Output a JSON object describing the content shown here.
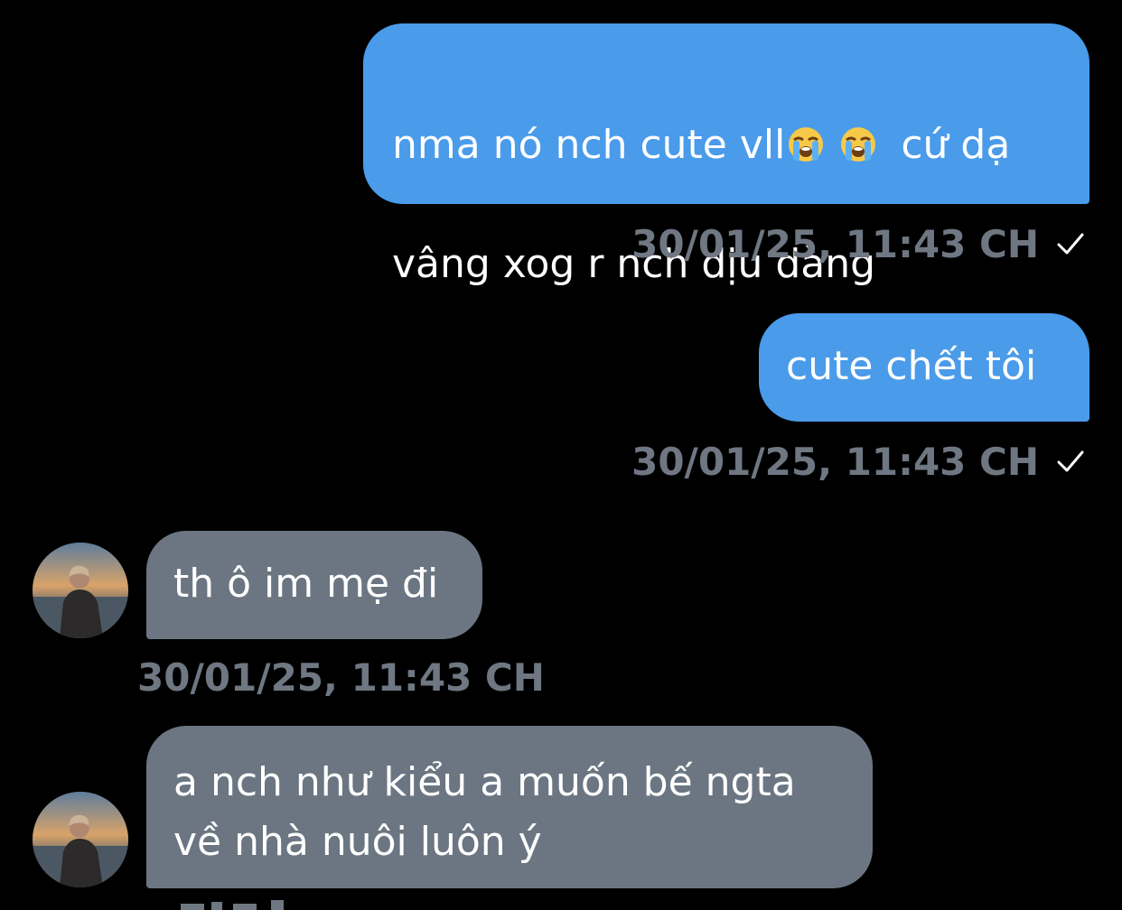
{
  "messages": [
    {
      "direction": "sent",
      "line1_text": "nma nó nch cute vll",
      "line1_emoji": "loudly-crying-face",
      "line1_tail": "cứ dạ",
      "line2": "vâng xog r nch dịu dàng",
      "timestamp": "30/01/25, 11:43 CH",
      "status": "check-icon"
    },
    {
      "direction": "sent",
      "text": "cute chết tôi",
      "timestamp": "30/01/25, 11:43 CH",
      "status": "check-icon"
    },
    {
      "direction": "received",
      "text": "th ô im mẹ đi",
      "timestamp": "30/01/25, 11:43 CH"
    },
    {
      "direction": "received",
      "text": "a nch như kiểu a muốn bế ngta\nvề nhà nuôi luôn ý"
    }
  ],
  "colors": {
    "background": "#000000",
    "sent_bubble": "#4a9bea",
    "received_bubble": "#6b7682",
    "timestamp": "#6e7782",
    "text": "#ffffff"
  }
}
